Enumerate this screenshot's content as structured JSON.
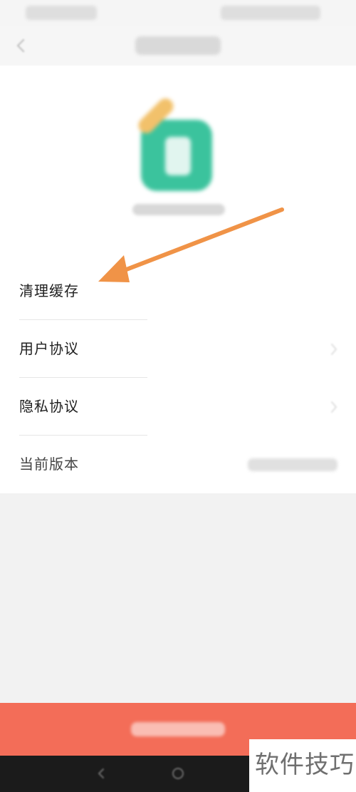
{
  "settings_list": {
    "items": [
      {
        "label": "清理缓存"
      },
      {
        "label": "用户协议"
      },
      {
        "label": "隐私协议"
      },
      {
        "label": "当前版本"
      }
    ]
  },
  "colors": {
    "accent_arrow": "#f09347",
    "logout_bar": "#f36d58",
    "app_logo": "#3bc39d"
  },
  "icons": {
    "back": "back-icon",
    "chevron": "chevron-right-icon",
    "arrow": "arrow-icon"
  },
  "watermark": {
    "text": "软件技巧"
  }
}
